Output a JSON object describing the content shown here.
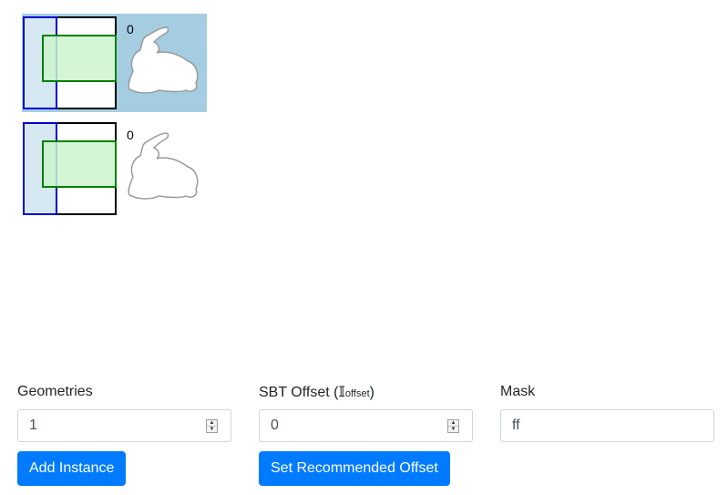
{
  "instances": [
    {
      "index_label": "0",
      "selected": true
    },
    {
      "index_label": "0",
      "selected": false
    }
  ],
  "form": {
    "geometries": {
      "label": "Geometries",
      "value": "1"
    },
    "sbt_offset": {
      "label_prefix": "SBT Offset (",
      "symbol": "𝕀",
      "subscript": "offset",
      "label_suffix": ")",
      "value": "0"
    },
    "mask": {
      "label": "Mask",
      "value": "ff"
    }
  },
  "buttons": {
    "add_instance": "Add Instance",
    "set_recommended_offset": "Set Recommended Offset"
  },
  "colors": {
    "accent": "#007bff",
    "selected_bg": "#a5cde2",
    "geometry_box": "#0000cc",
    "aabb_box": "#008000"
  }
}
